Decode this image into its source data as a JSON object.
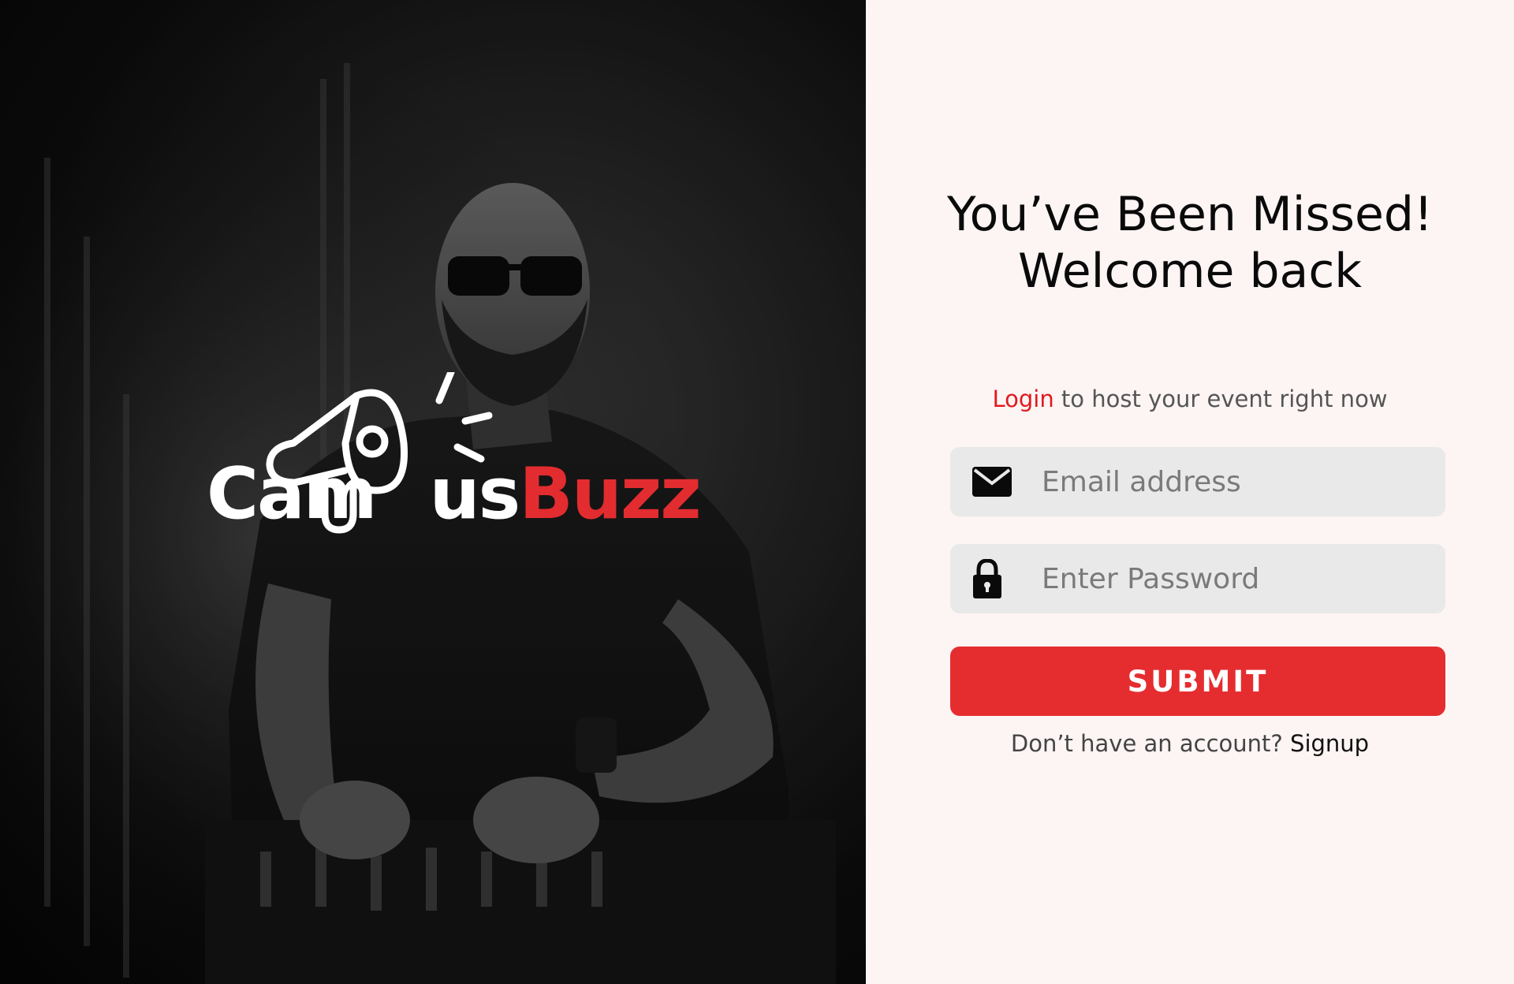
{
  "brand": {
    "part1": "Cam",
    "part2": "us",
    "part3": "Buzz",
    "accent_color": "#e32c2f"
  },
  "hero": {
    "image_subject": "dj-photo"
  },
  "login": {
    "heading_line1": "You’ve Been Missed!",
    "heading_line2": "Welcome back",
    "subtitle_accent": "Login",
    "subtitle_rest": " to host your event right now",
    "email_placeholder": "Email address",
    "password_placeholder": "Enter Password",
    "email_icon": "envelope-icon",
    "password_icon": "lock-icon",
    "submit_label": "SUBMIT",
    "signup_prompt": "Don’t have an account? ",
    "signup_link": "Signup",
    "button_color": "#e52d30",
    "field_bg": "#e9e9e9"
  }
}
